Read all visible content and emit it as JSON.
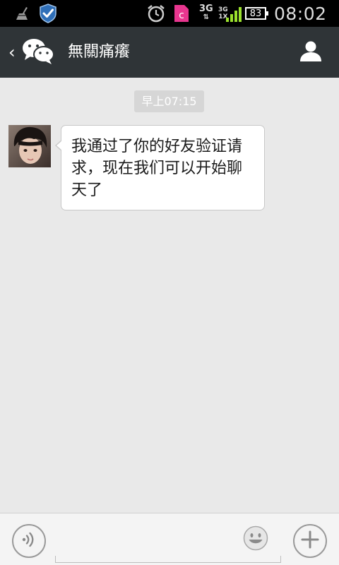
{
  "status_bar": {
    "network_3g": "3G",
    "network_3g_small": "3G",
    "network_1x": "1X",
    "battery": "83",
    "time": "08:02",
    "icons": [
      "clean-icon",
      "shield-icon",
      "alarm-icon",
      "app-c-icon",
      "signal-icon",
      "battery-icon"
    ]
  },
  "title_bar": {
    "back": "‹",
    "title": "無關痛癢",
    "icons": [
      "wechat-logo-icon",
      "profile-icon"
    ]
  },
  "chat": {
    "timestamp": "早上07:15",
    "messages": [
      {
        "sender": "other",
        "text": "我通过了你的好友验证请求，现在我们可以开始聊天了"
      }
    ]
  },
  "input_bar": {
    "text_value": "",
    "icons": [
      "voice-icon",
      "emoji-icon",
      "plus-icon"
    ]
  },
  "colors": {
    "status_bar_bg": "#000000",
    "title_bar_bg": "#2f3437",
    "chat_bg": "#e9e9e9",
    "timestamp_bg": "#d6d6d6",
    "signal_green": "#9be22d",
    "app_c_pink": "#e8368f"
  }
}
